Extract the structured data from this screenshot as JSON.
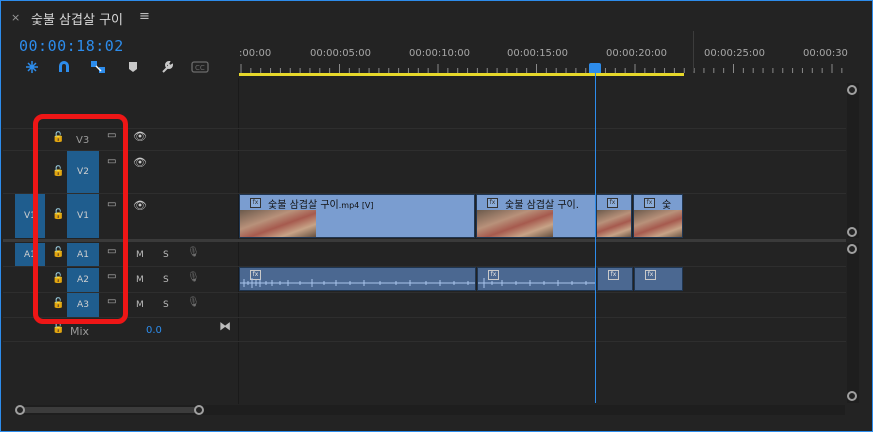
{
  "panel": {
    "close_glyph": "×",
    "title": "숯불 삼겹살 구이",
    "menu_glyph": "≡"
  },
  "timecode": "00:00:18:02",
  "tools": [
    {
      "name": "snap-in-nested-icon"
    },
    {
      "name": "magnet-snap-icon"
    },
    {
      "name": "linked-selection-icon"
    },
    {
      "name": "add-marker-icon"
    },
    {
      "name": "wrench-settings-icon"
    },
    {
      "name": "captions-icon"
    }
  ],
  "ruler": {
    "labels": [
      ":00:00",
      "00:00:05:00",
      "00:00:10:00",
      "00:00:15:00",
      "00:00:20:00",
      "00:00:25:00",
      "00:00:30"
    ]
  },
  "tracks": {
    "video": [
      {
        "id": "V3",
        "lock": "🔓",
        "sync": "▭",
        "eye": "👁"
      },
      {
        "id": "V2",
        "lock": "🔓",
        "sync": "▭",
        "eye": "👁"
      },
      {
        "id": "V1",
        "src": "V1",
        "lock": "🔓",
        "sync": "▭",
        "eye": "👁"
      }
    ],
    "audio": [
      {
        "id": "A1",
        "src": "A1",
        "lock": "🔓",
        "sync": "▭",
        "m": "M",
        "s": "S",
        "mic": "🎙"
      },
      {
        "id": "A2",
        "lock": "🔓",
        "sync": "▭",
        "m": "M",
        "s": "S",
        "mic": "🎙"
      },
      {
        "id": "A3",
        "lock": "🔓",
        "sync": "▭",
        "m": "M",
        "s": "S",
        "mic": "🎙"
      }
    ],
    "mix": {
      "lock": "🔓",
      "label": "Mix",
      "value": "0.0",
      "end_glyph": "⧓"
    }
  },
  "clips": {
    "video": [
      {
        "fx": "fx",
        "name": "숯불 삼겹살 구이",
        "suffix": ".mp4 [V]"
      },
      {
        "fx": "fx",
        "name": "숯불 삼겹살 구이.",
        "suffix": ""
      },
      {
        "fx": "fx",
        "name": "",
        "suffix": ""
      },
      {
        "fx": "fx",
        "name": "숯",
        "suffix": ""
      }
    ],
    "audio": [
      {
        "fx": "fx"
      },
      {
        "fx": "fx"
      },
      {
        "fx": "fx"
      },
      {
        "fx": "fx"
      }
    ]
  },
  "colors": {
    "accent": "#2d8ceb",
    "work_area": "#e7d82b",
    "video_clip": "#7a9dd0",
    "audio_clip": "#4b6891",
    "annotation": "#ee1616"
  }
}
